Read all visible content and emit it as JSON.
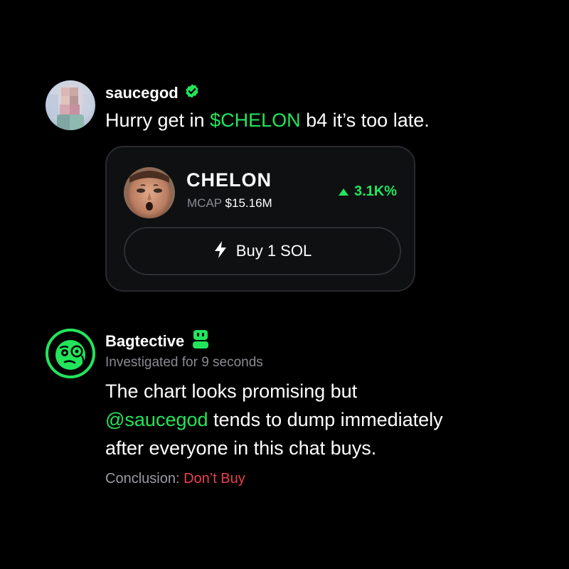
{
  "message1": {
    "username": "saucegod",
    "verified_icon": "verified-badge-icon",
    "text_before": "Hurry get in ",
    "ticker": "$CHELON",
    "text_after": " b4 it’s too late."
  },
  "token_card": {
    "name": "CHELON",
    "mcap_label": "MCAP",
    "mcap_value": "$15.16M",
    "change_icon": "triangle-up-icon",
    "change": "3.1K%",
    "buy_icon": "lightning-bolt-icon",
    "buy_label": "Buy 1 SOL"
  },
  "message2": {
    "username": "Bagtective",
    "bot_icon": "robot-icon",
    "investigated": "Investigated for 9 seconds",
    "line1": "The chart looks promising but",
    "mention": "@saucegod",
    "line2_rest": " tends to dump immediately",
    "line3": "after everyone in this chat buys.",
    "conclusion_label": "Conclusion: ",
    "conclusion_value": "Don’t Buy"
  },
  "colors": {
    "background": "#000000",
    "accent_green": "#22e55c",
    "danger_red": "#e8414c",
    "muted_text": "#8a8a92",
    "card_background": "#0f1012",
    "card_border": "#2a2a2e"
  }
}
